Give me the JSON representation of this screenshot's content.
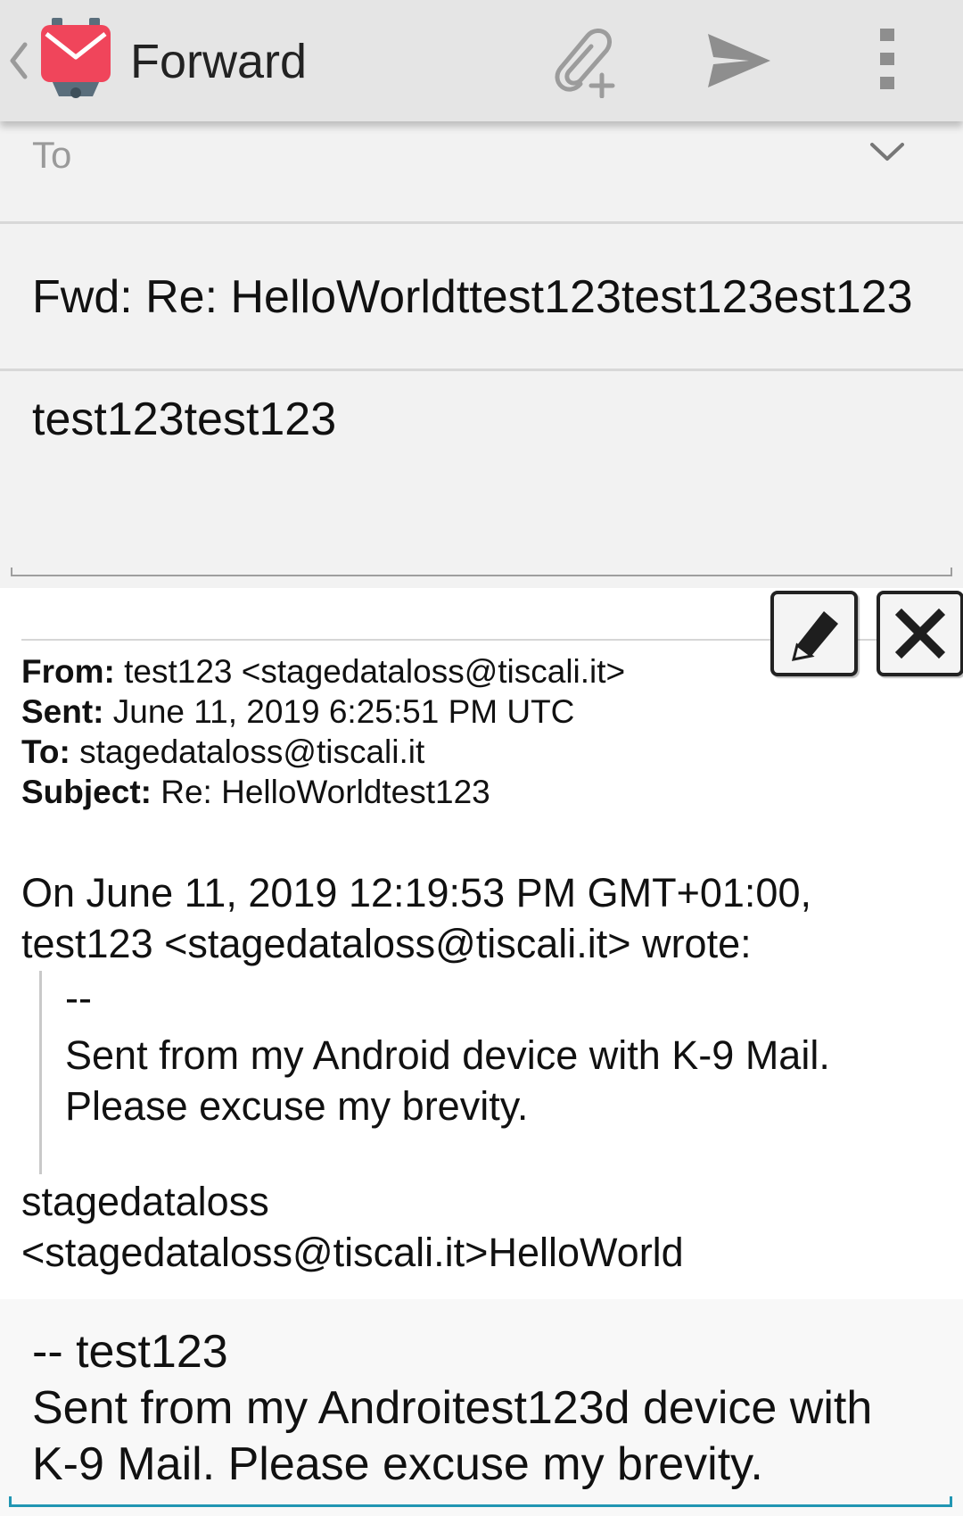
{
  "action_bar": {
    "title": "Forward",
    "icons": {
      "up": "chevron-left-icon",
      "logo": "k9-mail-logo",
      "attach": "attach-file-icon",
      "send": "send-icon",
      "more": "overflow-menu-icon"
    }
  },
  "compose": {
    "to_placeholder": "To",
    "subject": "Fwd: Re: HelloWorldttest123test123est123",
    "message": "test123test123"
  },
  "quoted": {
    "headers": [
      {
        "label": "From:",
        "value": "test123 <stagedataloss@tiscali.it>"
      },
      {
        "label": "Sent:",
        "value": "June 11, 2019 6:25:51 PM UTC"
      },
      {
        "label": "To:",
        "value": "stagedataloss@tiscali.it"
      },
      {
        "label": "Subject:",
        "value": "Re: HelloWorldtest123"
      }
    ],
    "intro_line1": "On June 11, 2019 12:19:53 PM GMT+01:00,",
    "intro_line2": "test123 <stagedataloss@tiscali.it> wrote:",
    "blockquote_dash": "--",
    "blockquote_line1": "Sent from my Android device with K-9 Mail.",
    "blockquote_line2": "Please excuse my brevity.",
    "tail_line1": "stagedataloss",
    "tail_line2": "<stagedataloss@tiscali.it>HelloWorld"
  },
  "signature": {
    "line1": "-- test123",
    "line2": "Sent from my Androitest123d device with",
    "line3": "K-9 Mail. Please excuse my brevity."
  },
  "colors": {
    "action_bar_bg": "#e5e5e5",
    "compose_bg": "#f2f2f2",
    "logo_red": "#f0455b",
    "accent_underline": "#2196b3"
  }
}
